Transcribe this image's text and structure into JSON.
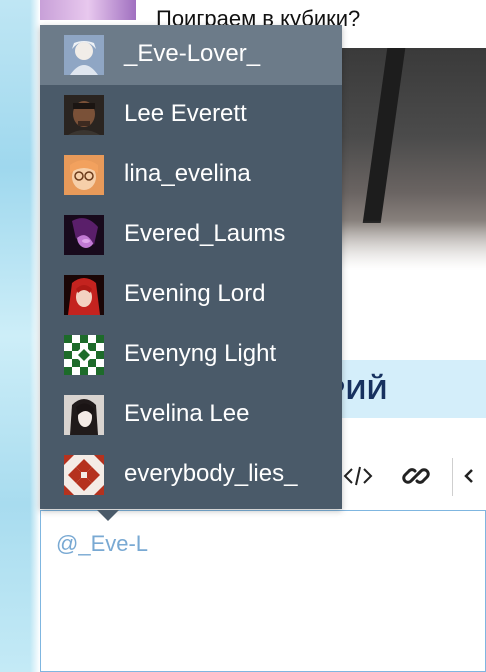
{
  "post": {
    "title": "Поиграем в кубики?"
  },
  "comment_section": {
    "heading": "АРИЙ"
  },
  "toolbar": {
    "code_icon": "code-icon",
    "link_icon": "link-icon",
    "more_icon": "arrow-icon"
  },
  "editor": {
    "value": "@_Eve-L"
  },
  "mentions": {
    "selected_index": 0,
    "items": [
      {
        "username": "_Eve-Lover_",
        "avatar": "avatar-anime-pale"
      },
      {
        "username": "Lee Everett",
        "avatar": "avatar-man-portrait"
      },
      {
        "username": "lina_evelina",
        "avatar": "avatar-orange-glasses"
      },
      {
        "username": "Evered_Laums",
        "avatar": "avatar-purple-dark"
      },
      {
        "username": "Evening Lord",
        "avatar": "avatar-red-hair"
      },
      {
        "username": "Evenyng Light",
        "avatar": "avatar-green-pattern"
      },
      {
        "username": "Evelina Lee",
        "avatar": "avatar-dark-hair-girl"
      },
      {
        "username": "everybody_lies_",
        "avatar": "avatar-red-pattern"
      }
    ]
  },
  "colors": {
    "dropdown_bg": "#4a5a69",
    "dropdown_selected": "#6c7b89",
    "editor_border": "#7fb6e0",
    "mention_text": "#79a9d3",
    "banner_bg": "#d4eefa",
    "banner_text": "#17315f"
  }
}
